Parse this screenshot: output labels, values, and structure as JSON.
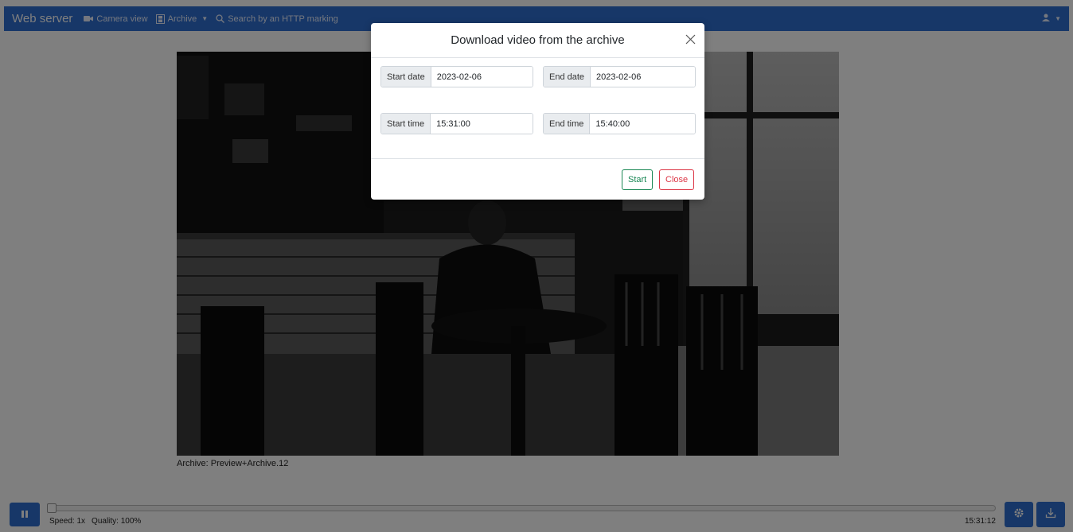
{
  "navbar": {
    "brand": "Web server",
    "camera_view": "Camera view",
    "archive": "Archive",
    "search": "Search by an HTTP marking"
  },
  "video": {
    "caption": "Archive: Preview+Archive.12"
  },
  "player": {
    "speed": "Speed: 1x",
    "quality": "Quality: 100%",
    "time": "15:31:12",
    "progress": 0.0
  },
  "modal": {
    "title": "Download video from the archive",
    "start_date_label": "Start date",
    "start_date_value": "2023-02-06",
    "end_date_label": "End date",
    "end_date_value": "2023-02-06",
    "start_time_label": "Start time",
    "start_time_value": "15:31:00",
    "end_time_label": "End time",
    "end_time_value": "15:40:00",
    "start_button": "Start",
    "close_button": "Close"
  },
  "colors": {
    "primary": "#2f6fd0",
    "success": "#198754",
    "danger": "#dc3545"
  }
}
